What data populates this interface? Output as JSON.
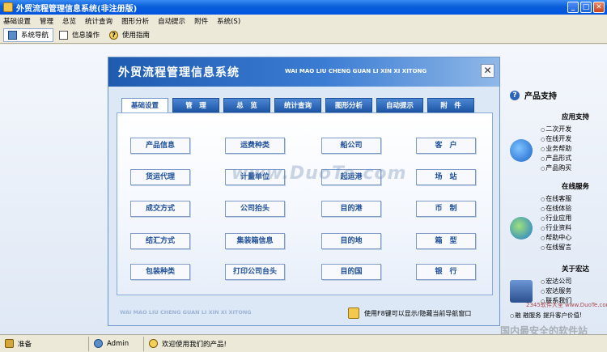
{
  "window": {
    "title": "外贸流程管理信息系统(非注册版)",
    "controls": [
      "_",
      "□",
      "✕"
    ]
  },
  "menu": [
    "基础设置",
    "管理",
    "总览",
    "统计查询",
    "图形分析",
    "自动提示",
    "附件",
    "系统(S)"
  ],
  "toolbar": [
    {
      "label": "系统导航",
      "icon": "navigation-icon",
      "active": true
    },
    {
      "label": "信息操作",
      "icon": "document-icon",
      "active": false
    },
    {
      "label": "使用指南",
      "icon": "help-icon",
      "active": false
    }
  ],
  "dialog": {
    "title": "外贸流程管理信息系统",
    "subtitle": "WAI MAO LIU CHENG GUAN LI XIN XI XITONG",
    "close": "✕",
    "tabs": [
      "基础设置",
      "管　理",
      "总　览",
      "统计查询",
      "图形分析",
      "自动提示",
      "附　件"
    ],
    "buttons": [
      [
        "产品信息",
        "运费种类",
        "船公司",
        "客　户"
      ],
      [
        "货运代理",
        "计量单位",
        "起运港",
        "场　站"
      ],
      [
        "成交方式",
        "公司抬头",
        "目的港",
        "币　制"
      ],
      [
        "结汇方式",
        "集装箱信息",
        "目的地",
        "箱　型"
      ],
      [
        "包装种类",
        "打印公司台头",
        "目的国",
        "银　行"
      ]
    ],
    "footer_subtitle": "WAI MAO LIU CHENG GUAN LI XIN XI XITONG",
    "footer_hint": "使用F8键可以显示/隐藏当前导航窗口"
  },
  "right_panel": {
    "title": "产品支持",
    "sections": [
      {
        "heading": "应用支持",
        "items": [
          "二次开发",
          "在线开发",
          "业务帮助",
          "产品形式",
          "产品购买"
        ]
      },
      {
        "heading": "在线服务",
        "items": [
          "在线客服",
          "在线体验",
          "行业应用",
          "行业资料",
          "帮助中心",
          "在线留言"
        ]
      },
      {
        "heading": "关于宏达",
        "items": [
          "宏达公司",
          "宏达服务",
          "联系我们"
        ]
      }
    ],
    "tagline": "融 融服务  提升客户价值!"
  },
  "watermark": {
    "main": "www.DuoTe.com",
    "brand": "2345软件大全 www.DuoTe.com",
    "slogan": "国内最安全的软件站"
  },
  "status": [
    {
      "label": "准备",
      "icon": "ready-icon"
    },
    {
      "label": "Admin",
      "icon": "user-icon"
    },
    {
      "label": "欢迎使用我们的产品!",
      "icon": "message-icon"
    }
  ]
}
